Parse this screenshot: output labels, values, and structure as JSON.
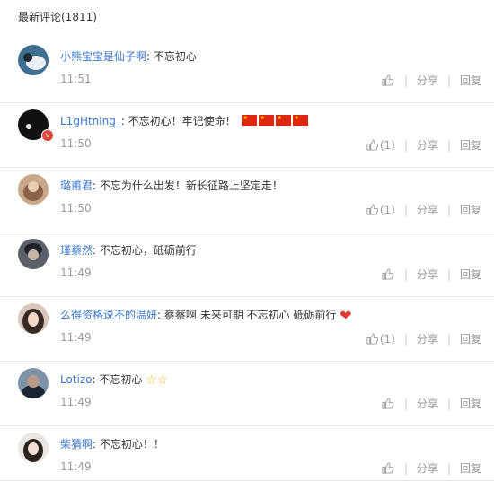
{
  "header": {
    "title": "最新评论(1811)"
  },
  "comments": [
    {
      "username": "小熊宝宝是仙子啊",
      "text": ": 不忘初心",
      "time": "11:51",
      "likes": "",
      "share": "分享",
      "reply": "回复"
    },
    {
      "username": "L1gHtning_",
      "text": ": 不忘初心！牢记使命！",
      "time": "11:50",
      "likes": "(1)",
      "share": "分享",
      "reply": "回复"
    },
    {
      "username": "璐甫君",
      "text": ": 不忘为什么出发！新长征路上坚定走！",
      "time": "11:50",
      "likes": "(1)",
      "share": "分享",
      "reply": "回复"
    },
    {
      "username": "瑾蔡然",
      "text": ": 不忘初心，砥砺前行",
      "time": "11:49",
      "likes": "",
      "share": "分享",
      "reply": "回复"
    },
    {
      "username": "么得资格说不的温妍",
      "text": ": 蔡蔡啊 未来可期 不忘初心 砥砺前行",
      "time": "11:49",
      "likes": "(1)",
      "share": "分享",
      "reply": "回复"
    },
    {
      "username": "Lotizo",
      "text": ": 不忘初心",
      "time": "11:49",
      "likes": "",
      "share": "分享",
      "reply": "回复"
    },
    {
      "username": "柴猜啊",
      "text": ": 不忘初心！！",
      "time": "11:49",
      "likes": "",
      "share": "分享",
      "reply": "回复"
    }
  ],
  "colors": {
    "link": "#3b7ad1",
    "muted": "#9a9a9a",
    "flag": "#de2910",
    "heart": "#e53935",
    "star": "#f3c11b"
  }
}
